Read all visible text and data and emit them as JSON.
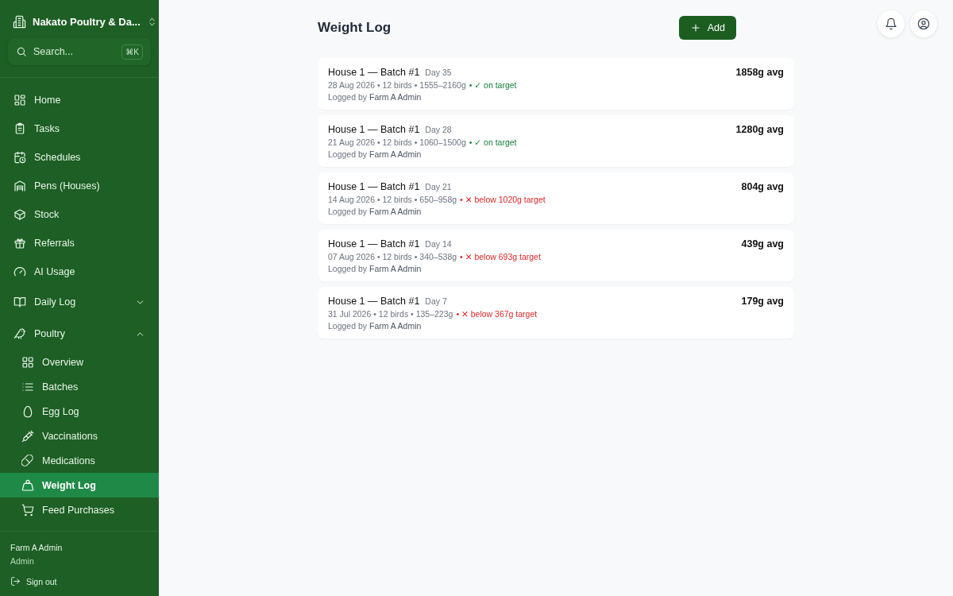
{
  "sidebar": {
    "org": "Nakato Poultry & Da...",
    "search": {
      "placeholder": "Search...",
      "shortcut": "⌘K"
    },
    "items": [
      {
        "label": "Home",
        "selected": false
      },
      {
        "label": "Tasks",
        "selected": false
      },
      {
        "label": "Schedules",
        "selected": false
      },
      {
        "label": "Pens (Houses)",
        "selected": false
      },
      {
        "label": "Stock",
        "selected": false
      },
      {
        "label": "Referrals",
        "selected": false
      },
      {
        "label": "AI Usage",
        "selected": false
      },
      {
        "label": "Daily Log",
        "selected": false,
        "expanded": false
      },
      {
        "label": "Poultry",
        "selected": false,
        "expanded": true,
        "children": [
          {
            "label": "Overview",
            "selected": false
          },
          {
            "label": "Batches",
            "selected": false
          },
          {
            "label": "Egg Log",
            "selected": false
          },
          {
            "label": "Vaccinations",
            "selected": false
          },
          {
            "label": "Medications",
            "selected": false
          },
          {
            "label": "Weight Log",
            "selected": true
          },
          {
            "label": "Feed Purchases",
            "selected": false
          }
        ]
      }
    ],
    "user": {
      "name": "Farm A Admin",
      "role": "Admin",
      "sign_out": "Sign out"
    }
  },
  "page": {
    "title": "Weight Log",
    "add_button": "Add"
  },
  "entries": [
    {
      "title": "House 1 — Batch #1",
      "day": "Day 35",
      "details": "28 Aug 2026 • 12 birds • 1555–2160g",
      "on_target": true,
      "status": "• ✓ on target",
      "logged_by_label": "Logged by",
      "logged_by": "Farm A Admin",
      "average": "1858g avg"
    },
    {
      "title": "House 1 — Batch #1",
      "day": "Day 28",
      "details": "21 Aug 2026 • 12 birds • 1060–1500g",
      "on_target": true,
      "status": "• ✓ on target",
      "logged_by_label": "Logged by",
      "logged_by": "Farm A Admin",
      "average": "1280g avg"
    },
    {
      "title": "House 1 — Batch #1",
      "day": "Day 21",
      "details": "14 Aug 2026 • 12 birds • 650–958g",
      "on_target": false,
      "status": "• ✕ below 1020g target",
      "logged_by_label": "Logged by",
      "logged_by": "Farm A Admin",
      "average": "804g avg"
    },
    {
      "title": "House 1 — Batch #1",
      "day": "Day 14",
      "details": "07 Aug 2026 • 12 birds • 340–538g",
      "on_target": false,
      "status": "• ✕ below 693g target",
      "logged_by_label": "Logged by",
      "logged_by": "Farm A Admin",
      "average": "439g avg"
    },
    {
      "title": "House 1 — Batch #1",
      "day": "Day 7",
      "details": "31 Jul 2026 • 12 birds • 135–223g",
      "on_target": false,
      "status": "• ✕ below 367g target",
      "logged_by_label": "Logged by",
      "logged_by": "Farm A Admin",
      "average": "179g avg"
    }
  ]
}
